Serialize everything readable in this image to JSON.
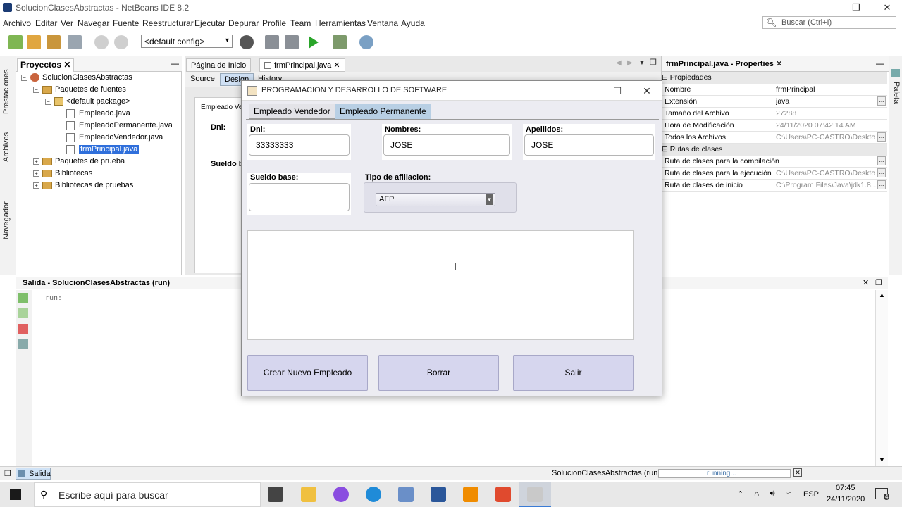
{
  "window": {
    "title": "SolucionClasesAbstractas - NetBeans IDE 8.2",
    "controls": {
      "minimize": "—",
      "restore": "❐",
      "close": "✕"
    }
  },
  "menu": [
    "Archivo",
    "Editar",
    "Ver",
    "Navegar",
    "Fuente",
    "Reestructurar",
    "Ejecutar",
    "Depurar",
    "Profile",
    "Team",
    "Herramientas",
    "Ventana",
    "Ayuda"
  ],
  "search": {
    "placeholder": "Buscar (Ctrl+I)"
  },
  "toolbar": {
    "config": "<default config>"
  },
  "side_tabs": {
    "left": [
      "Prestaciones",
      "Archivos",
      "Navegador"
    ],
    "right": "Paleta"
  },
  "projects": {
    "title": "Proyectos",
    "tree": [
      {
        "label": "SolucionClasesAbstractas",
        "level": 0,
        "kind": "project",
        "exp": "−"
      },
      {
        "label": "Paquetes de fuentes",
        "level": 1,
        "kind": "folder",
        "exp": "−"
      },
      {
        "label": "<default package>",
        "level": 2,
        "kind": "package",
        "exp": "−"
      },
      {
        "label": "Empleado.java",
        "level": 3,
        "kind": "file"
      },
      {
        "label": "EmpleadoPermanente.java",
        "level": 3,
        "kind": "file"
      },
      {
        "label": "EmpleadoVendedor.java",
        "level": 3,
        "kind": "file"
      },
      {
        "label": "frmPrincipal.java",
        "level": 3,
        "kind": "file",
        "selected": true
      },
      {
        "label": "Paquetes de prueba",
        "level": 1,
        "kind": "folder",
        "exp": "+"
      },
      {
        "label": "Bibliotecas",
        "level": 1,
        "kind": "folder",
        "exp": "+"
      },
      {
        "label": "Bibliotecas de pruebas",
        "level": 1,
        "kind": "folder",
        "exp": "+"
      }
    ]
  },
  "editor": {
    "tabs": [
      "Página de Inicio",
      "frmPrincipal.java"
    ],
    "subtabs": [
      "Source",
      "Design",
      "History"
    ],
    "design_tab_fragment": "Empleado Ve",
    "design_labels": [
      "Dni:",
      "Sueldo b"
    ]
  },
  "properties": {
    "title": "frmPrincipal.java - Properties",
    "sections": [
      {
        "name": "Propiedades",
        "rows": [
          {
            "key": "Nombre",
            "value": "frmPrincipal",
            "dim": false
          },
          {
            "key": "Extensión",
            "value": "java",
            "dim": false,
            "dots": true
          },
          {
            "key": "Tamaño del Archivo",
            "value": "27288",
            "dim": true
          },
          {
            "key": "Hora de Modificación",
            "value": "24/11/2020 07:42:14 AM",
            "dim": true
          },
          {
            "key": "Todos los Archivos",
            "value": "C:\\Users\\PC-CASTRO\\Deskto...",
            "dim": true,
            "dots": true
          }
        ]
      },
      {
        "name": "Rutas de clases",
        "rows": [
          {
            "key": "Ruta de clases para la compilación",
            "value": "",
            "dim": true,
            "dots": true
          },
          {
            "key": "Ruta de clases para la ejecución",
            "value": "C:\\Users\\PC-CASTRO\\Deskto...",
            "dim": true,
            "dots": true
          },
          {
            "key": "Ruta de clases de inicio",
            "value": "C:\\Program Files\\Java\\jdk1.8...",
            "dim": true,
            "dots": true
          }
        ]
      }
    ]
  },
  "output": {
    "title": "Salida - SolucionClasesAbstractas (run)",
    "text": "run:"
  },
  "status": {
    "output_tab": "Salida",
    "task": "SolucionClasesAbstractas (run)",
    "progress_text": "running..."
  },
  "dialog": {
    "title": "PROGRAMACION Y DESARROLLO DE SOFTWARE",
    "tabs": [
      "Empleado Vendedor",
      "Empleado Permanente"
    ],
    "active_tab": "Empleado Permanente",
    "fields": {
      "dni": {
        "label": "Dni:",
        "value": "33333333"
      },
      "nombres": {
        "label": "Nombres:",
        "value": "JOSE"
      },
      "apellidos": {
        "label": "Apellidos:",
        "value": "JOSE"
      },
      "sueldo": {
        "label": "Sueldo base:",
        "value": ""
      },
      "afiliacion": {
        "label": "Tipo de afiliacion:",
        "value": "AFP"
      }
    },
    "buttons": {
      "crear": "Crear Nuevo Empleado",
      "borrar": "Borrar",
      "salir": "Salir"
    }
  },
  "taskbar": {
    "search_placeholder": "Escribe aquí para buscar",
    "lang": "ESP",
    "time": "07:45",
    "date": "24/11/2020",
    "notifications": "4"
  }
}
